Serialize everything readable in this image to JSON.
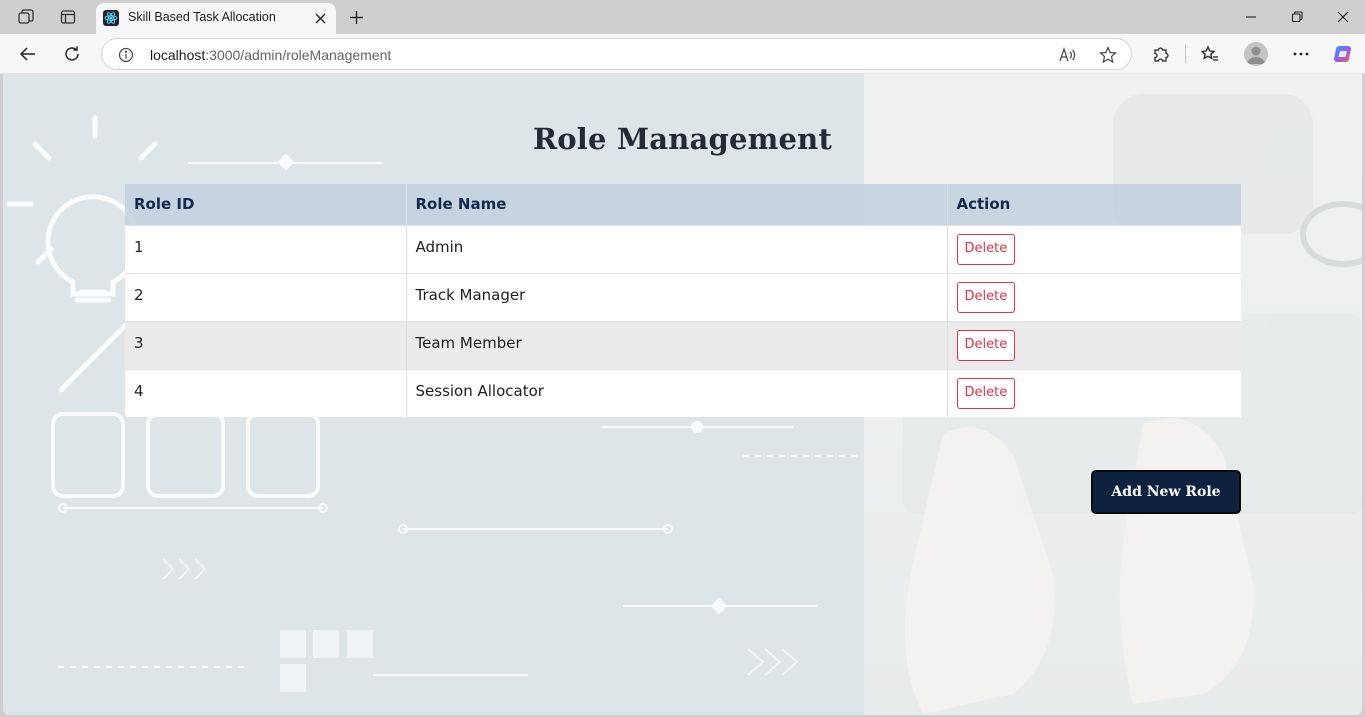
{
  "browser": {
    "tab_title": "Skill Based Task Allocation",
    "url_host": "localhost",
    "url_rest": ":3000/admin/roleManagement",
    "icons": {
      "workspaces": "workspaces-icon",
      "tab_actions": "tab-actions-icon",
      "favicon": "react-logo-icon",
      "close_tab": "close-icon",
      "new_tab": "plus-icon",
      "minimize": "minimize-icon",
      "restore": "restore-icon",
      "close_window": "close-icon",
      "back": "back-arrow-icon",
      "refresh": "refresh-icon",
      "info": "info-icon",
      "read_aloud": "read-aloud-icon",
      "favorite": "star-icon",
      "extensions": "puzzle-icon",
      "favorites_bar": "favorites-icon",
      "profile": "profile-icon",
      "more": "more-icon",
      "copilot": "copilot-icon"
    }
  },
  "page": {
    "title": "Role Management",
    "table": {
      "headers": [
        "Role ID",
        "Role Name",
        "Action"
      ],
      "rows": [
        {
          "id": "1",
          "name": "Admin",
          "action": "Delete"
        },
        {
          "id": "2",
          "name": "Track Manager",
          "action": "Delete"
        },
        {
          "id": "3",
          "name": "Team Member",
          "action": "Delete"
        },
        {
          "id": "4",
          "name": "Session Allocator",
          "action": "Delete"
        }
      ]
    },
    "add_button_label": "Add New Role"
  },
  "colors": {
    "header_text": "#15284a",
    "header_bg": "#c0d0de",
    "delete_red": "#dc3545",
    "add_button_bg": "#0e2240"
  }
}
